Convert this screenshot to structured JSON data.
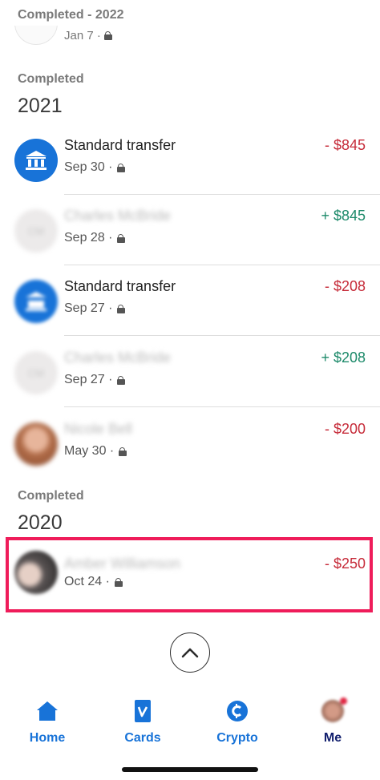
{
  "sticky": {
    "label": "Completed - 2022",
    "partial_date": "Jan 7 ·"
  },
  "sections": [
    {
      "label": "Completed",
      "year": "2021"
    },
    {
      "label": "Completed",
      "year": "2020"
    }
  ],
  "transactions": [
    {
      "title": "Standard transfer",
      "date": "Sep 30 ·",
      "amount": "- $845"
    },
    {
      "title": "Charles McBride",
      "date": "Sep 28 ·",
      "amount": "+ $845"
    },
    {
      "title": "Standard transfer",
      "date": "Sep 27 ·",
      "amount": "- $208"
    },
    {
      "title": "Charles McBride",
      "date": "Sep 27 ·",
      "amount": "+ $208"
    },
    {
      "title": "Nicole Bell",
      "date": "May 30 ·",
      "amount": "- $200"
    },
    {
      "title": "Amber Williamson",
      "date": "Oct 24 ·",
      "amount": "- $250"
    }
  ],
  "avatar_initials": "CM",
  "tabs": [
    {
      "label": "Home",
      "icon": "home-icon"
    },
    {
      "label": "Cards",
      "icon": "venmo-card-icon"
    },
    {
      "label": "Crypto",
      "icon": "crypto-icon"
    },
    {
      "label": "Me",
      "icon": "profile-avatar"
    }
  ],
  "colors": {
    "accent": "#1873d8",
    "negative": "#c62b39",
    "positive": "#1d8a6a",
    "highlight": "#ef1c5a",
    "me_tab": "#13206e"
  }
}
